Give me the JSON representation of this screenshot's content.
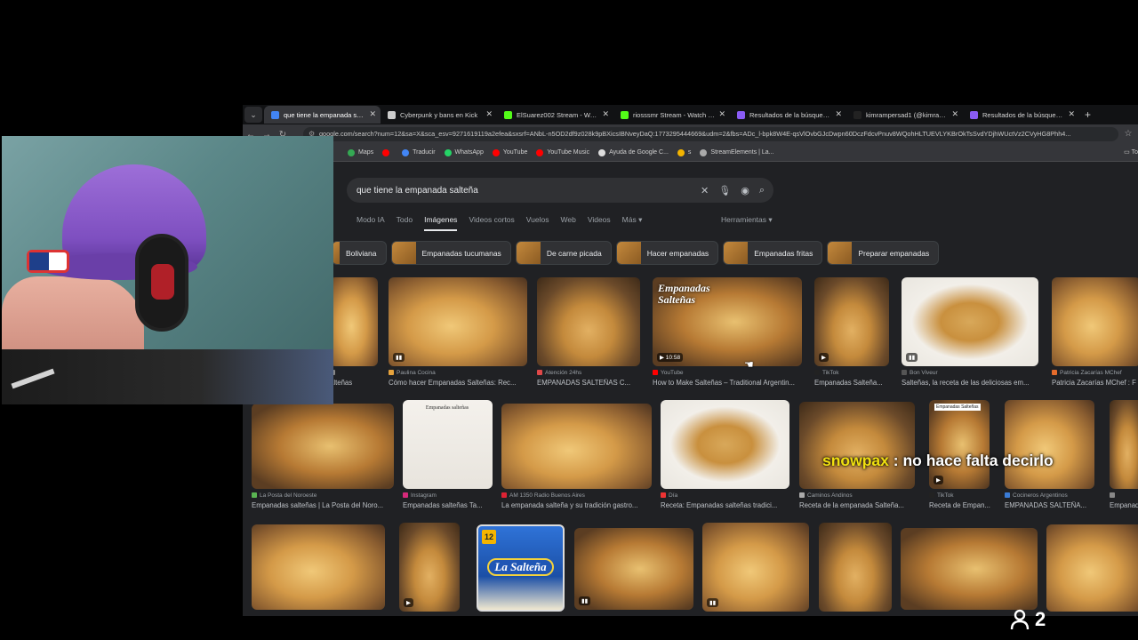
{
  "browser": {
    "tabs": [
      {
        "title": "que tiene la empanada salteñ",
        "color": "#4285f4",
        "active": true
      },
      {
        "title": "Cyberpunk y bans en Kick",
        "color": "#cccccc",
        "active": false
      },
      {
        "title": "ElSuarez002 Stream - Watch Li",
        "color": "#53fc18",
        "active": false
      },
      {
        "title": "riosssmr Stream - Watch Live o",
        "color": "#53fc18",
        "active": false
      },
      {
        "title": "Resultados de la búsqueda de",
        "color": "#8a5cf5",
        "active": false
      },
      {
        "title": "kimrampersad1 (@kimramper",
        "color": "#222222",
        "active": false
      },
      {
        "title": "Resultados de la búsqueda de",
        "color": "#8a5cf5",
        "active": false
      }
    ],
    "url": "google.com/search?num=12&sa=X&sca_esv=9271619119a2efea&sxsrf=ANbL-n5OD2df9z028k9pBXicsIBNveyDaQ:1773295444669&udm=2&fbs=ADc_l-bpk8W4E-qsVlOvbGJcDwpn60DczFdcvPnuv8WQohHLTUEVLYKBrOkTsSvdYDjhWUctVz2CVyHG8Phh4...",
    "bookmarks": [
      {
        "label": "Maps",
        "color": "#34a853"
      },
      {
        "label": "",
        "color": "#ff0000"
      },
      {
        "label": "Traducir",
        "color": "#4285f4"
      },
      {
        "label": "WhatsApp",
        "color": "#25d366"
      },
      {
        "label": "YouTube",
        "color": "#ff0000"
      },
      {
        "label": "YouTube Music",
        "color": "#ff0000"
      },
      {
        "label": "Ayuda de Google C...",
        "color": "#dddddd"
      },
      {
        "label": "s",
        "color": "#f4b400"
      },
      {
        "label": "StreamElements | La...",
        "color": "#aaaaaa"
      }
    ],
    "all_bookmarks": "To"
  },
  "google": {
    "query": "que tiene la empanada salteña",
    "tabs": [
      "Modo IA",
      "Todo",
      "Imágenes",
      "Videos cortos",
      "Vuelos",
      "Web",
      "Videos",
      "Más ▾"
    ],
    "active_tab": "Imágenes",
    "tools": "Herramientas ▾",
    "chips": [
      "Boliviana",
      "Empanadas tucumanas",
      "De carne picada",
      "Hacer empanadas",
      "Empanadas fritas",
      "Preparar empanadas"
    ]
  },
  "results": {
    "row1": [
      {
        "source": "",
        "title": "alteñas",
        "badge": "",
        "src_color": "#888"
      },
      {
        "source": "Paulina Cocina",
        "title": "Cómo hacer Empanadas Salteñas: Rec...",
        "badge": "▮▮",
        "src_color": "#e6a23c"
      },
      {
        "source": "Atención 24hs",
        "title": "EMPANADAS SALTEÑAS C...",
        "badge": "",
        "src_color": "#e04848"
      },
      {
        "source": "YouTube",
        "title": "How to Make Salteñas – Traditional Argentin...",
        "badge": "▶ 10:58",
        "src_color": "#ff0000"
      },
      {
        "source": "TikTok",
        "title": "Empanadas Salteña...",
        "badge": "▶",
        "src_color": "#222"
      },
      {
        "source": "Bon Viveur",
        "title": "Salteñas, la receta de las deliciosas em...",
        "badge": "▮▮",
        "src_color": "#555"
      },
      {
        "source": "Patricia Zacarías MChef",
        "title": "Patricia Zacarías MChef : F",
        "badge": "",
        "src_color": "#e46b2b"
      }
    ],
    "row2": [
      {
        "source": "La Posta del Noroeste",
        "title": "Empanadas salteñas | La Posta del Noro...",
        "badge": "",
        "src_color": "#5ab552"
      },
      {
        "source": "Instagram",
        "title": "Empanadas salteñas Ta...",
        "badge": "",
        "src_color": "#d6297a"
      },
      {
        "source": "AM 1350 Radio Buenos Aires",
        "title": "La empanada salteña y su tradición gastro...",
        "badge": "",
        "src_color": "#d23"
      },
      {
        "source": "Día",
        "title": "Receta: Empanadas salteñas tradici...",
        "badge": "",
        "src_color": "#e33"
      },
      {
        "source": "Caminos Andinos",
        "title": "Receta de la empanada Salteña...",
        "badge": "",
        "src_color": "#aaa"
      },
      {
        "source": "TikTok",
        "title": "Receta de Empan...",
        "badge": "▶",
        "src_color": "#222"
      },
      {
        "source": "Cocineros Argentinos",
        "title": "EMPANADAS SALTEÑA...",
        "badge": "",
        "src_color": "#3a7bd5"
      },
      {
        "source": "",
        "title": "Empanad",
        "badge": "",
        "src_color": "#888"
      }
    ],
    "row3_badges": [
      "",
      "▶",
      "",
      "▮▮",
      "▮▮",
      "",
      "",
      ""
    ],
    "overlay_texts": {
      "youtube_thumb": "Empanadas Salteñas",
      "recipe_card": "Empanadas salteñas",
      "pkg_brand": "La Salteña",
      "pkg_count": "12",
      "row2_tag": "Empanadas Salteñas"
    }
  },
  "stream": {
    "chat_user": "snowpax",
    "chat_message": ": no hace falta decirlo",
    "viewer_count": "2"
  }
}
